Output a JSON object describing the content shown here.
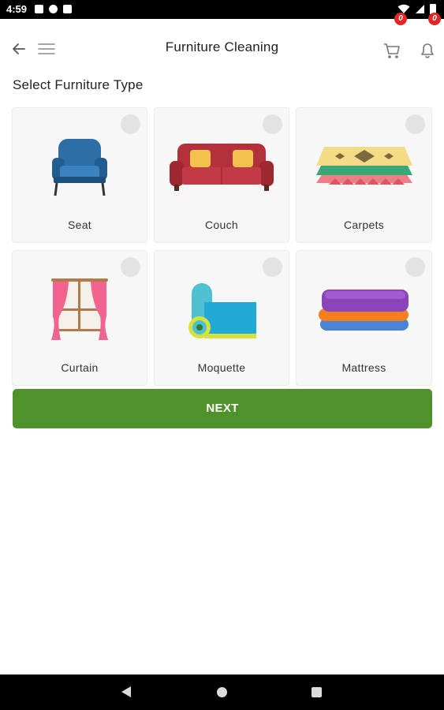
{
  "status_bar": {
    "time": "4:59"
  },
  "header": {
    "title": "Furniture Cleaning",
    "cart_count": "0",
    "notification_count": "0"
  },
  "section_title": "Select Furniture Type",
  "furniture_types": [
    {
      "label": "Seat",
      "icon": "armchair-icon"
    },
    {
      "label": "Couch",
      "icon": "sofa-icon"
    },
    {
      "label": "Carpets",
      "icon": "carpet-icon"
    },
    {
      "label": "Curtain",
      "icon": "curtain-icon"
    },
    {
      "label": "Moquette",
      "icon": "moquette-roll-icon"
    },
    {
      "label": "Mattress",
      "icon": "mattress-stack-icon"
    }
  ],
  "next_button": {
    "label": "NEXT"
  },
  "colors": {
    "primary": "#4f922b",
    "badge": "#e32727"
  }
}
